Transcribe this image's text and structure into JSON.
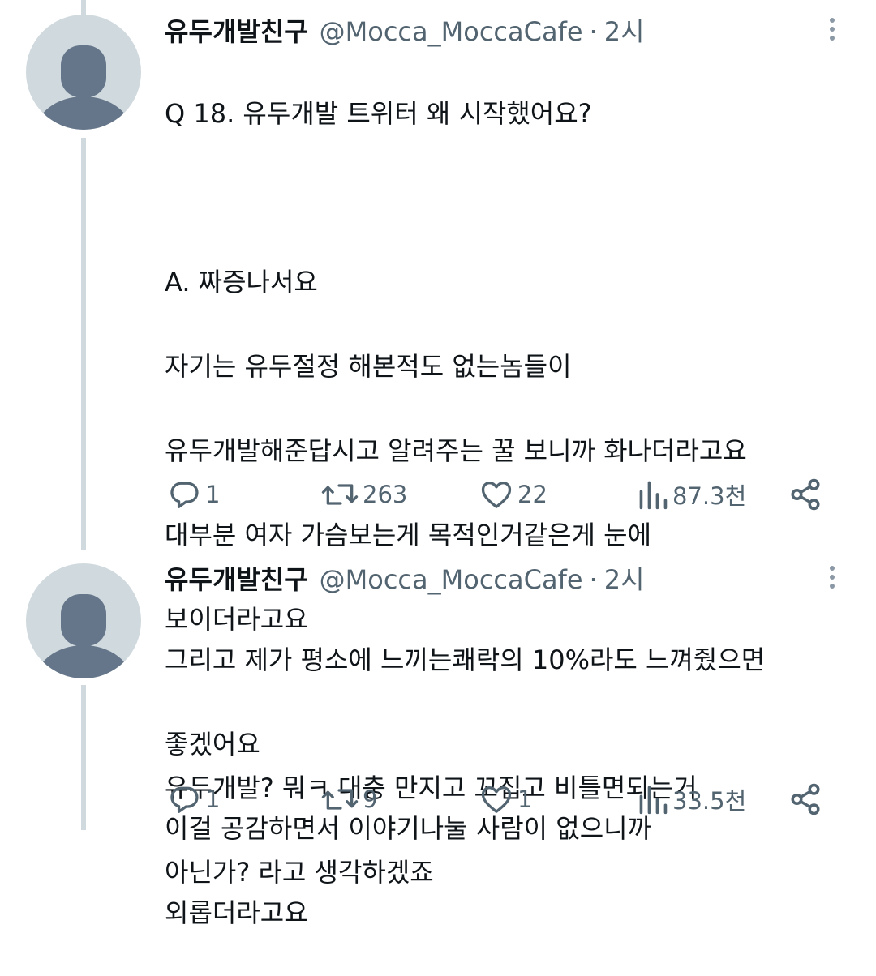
{
  "tweets": [
    {
      "author_name": "유두개발친구",
      "handle": "@Mocca_MoccaCafe",
      "separator": "·",
      "time": "2시",
      "lines": [
        "Q 18. 유두개발 트위터 왜 시작했어요?",
        "",
        "A. 짜증나서요",
        "자기는 유두절정 해본적도 없는놈들이",
        "유두개발해준답시고 알려주는 꿀 보니까 화나더라고요",
        "대부분 여자 가슴보는게 목적인거같은게 눈에",
        "보이더라고요",
        "",
        "유두개발? 뭐ㅋ 대충 만지고 꼬집고 비틀면되는거",
        "아닌가? 라고 생각하겠죠"
      ],
      "stats": {
        "replies": "1",
        "retweets": "263",
        "likes": "22",
        "views": "87.3천"
      }
    },
    {
      "author_name": "유두개발친구",
      "handle": "@Mocca_MoccaCafe",
      "separator": "·",
      "time": "2시",
      "lines": [
        "그리고 제가 평소에 느끼는쾌락의 10%라도 느껴줬으면",
        "좋겠어요",
        "이걸 공감하면서 이야기나눌 사람이 없으니까",
        "외롭더라고요"
      ],
      "stats": {
        "replies": "1",
        "retweets": "9",
        "likes": "1",
        "views": "33.5천"
      }
    }
  ],
  "icons": {
    "reply": "reply-icon",
    "retweet": "retweet-icon",
    "like": "heart-icon",
    "views": "views-bar-chart-icon",
    "share": "share-icon",
    "more": "more-vertical-icon",
    "avatar": "default-avatar-icon"
  },
  "colors": {
    "text": "#0f1419",
    "secondary": "#536471",
    "thread_line": "#cfd9de",
    "avatar_bg": "#cfd9de",
    "avatar_fg": "#66768a"
  }
}
